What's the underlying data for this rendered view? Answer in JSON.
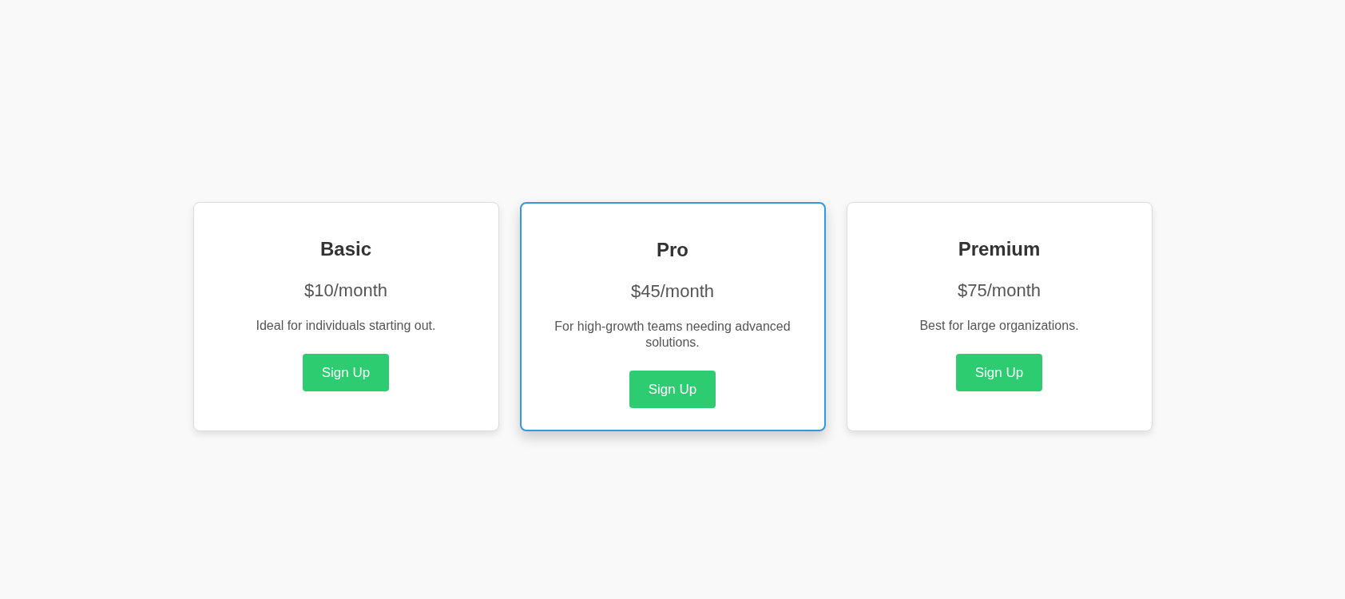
{
  "plans": [
    {
      "name": "Basic",
      "price": "$10/month",
      "description": "Ideal for individuals starting out.",
      "button": "Sign Up",
      "selected": false
    },
    {
      "name": "Pro",
      "price": "$45/month",
      "description": "For high-growth teams needing advanced solutions.",
      "button": "Sign Up",
      "selected": true
    },
    {
      "name": "Premium",
      "price": "$75/month",
      "description": "Best for large organizations.",
      "button": "Sign Up",
      "selected": false
    }
  ]
}
